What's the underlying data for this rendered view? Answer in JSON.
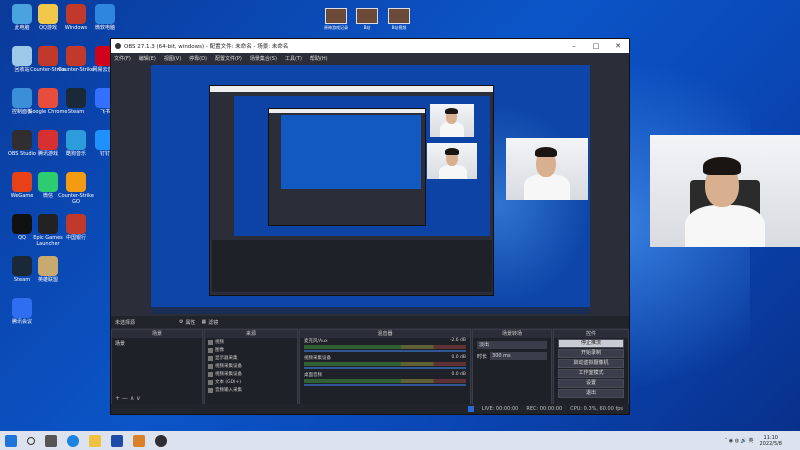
{
  "desktop": {
    "icons": [
      {
        "label": "此电脑",
        "color": "#4aa3df"
      },
      {
        "label": "QQ游戏",
        "color": "#f2c84b"
      },
      {
        "label": "Windows",
        "color": "#c0392b"
      },
      {
        "label": "微软电脑",
        "color": "#2e86de"
      },
      {
        "label": "回收站",
        "color": "#9ec9e8"
      },
      {
        "label": "Counter-Strike",
        "color": "#c0392b"
      },
      {
        "label": "Counter-Strike",
        "color": "#c0392b"
      },
      {
        "label": "控制面板",
        "color": "#3b8fd8"
      },
      {
        "label": "Google Chrome",
        "color": "#e74c3c"
      },
      {
        "label": "Steam",
        "color": "#1b2838"
      },
      {
        "label": "网易云音乐",
        "color": "#d0021b"
      },
      {
        "label": "OBS Studio",
        "color": "#302e31"
      },
      {
        "label": "腾讯游戏",
        "color": "#d63031"
      },
      {
        "label": "酷狗音乐",
        "color": "#2d9cdb"
      },
      {
        "label": "WeGame",
        "color": "#e84118"
      },
      {
        "label": "微信",
        "color": "#2ecc71"
      },
      {
        "label": "Counter-Strike GO",
        "color": "#f39c12"
      },
      {
        "label": "飞书",
        "color": "#3370ff"
      },
      {
        "label": "钉钉",
        "color": "#1e90ff"
      },
      {
        "label": "QQ",
        "color": "#111"
      },
      {
        "label": "Steam",
        "color": "#1b2838"
      },
      {
        "label": "Epic Games Launcher",
        "color": "#222"
      },
      {
        "label": "中国银行",
        "color": "#c0392b"
      },
      {
        "label": "腾讯会议",
        "color": "#2f6ef0"
      },
      {
        "label": "英雄联盟",
        "color": "#c8aa6e"
      }
    ],
    "top_files": [
      "原神游戏记录",
      "B站",
      "B站视频"
    ]
  },
  "obs": {
    "title": "OBS 27.1.3 (64-bit, windows) - 配置文件: 未命名 - 场景: 未命名",
    "menu": [
      "文件(F)",
      "编辑(E)",
      "视图(V)",
      "停靠(D)",
      "配置文件(P)",
      "场景集合(S)",
      "工具(T)",
      "帮助(H)"
    ],
    "no_source": "未选择源",
    "properties_label": "属性",
    "filters_label": "滤镜",
    "scenes_header": "场景",
    "scene_item": "场景",
    "sources_header": "来源",
    "sources": [
      "视频",
      "图像",
      "显示器采集",
      "视频采集设备",
      "视频采集设备",
      "文本 (GDI+)",
      "音频输入采集"
    ],
    "mixer_header": "混音器",
    "mixer": [
      {
        "name": "麦克风/Aux",
        "db": "-2.6 dB"
      },
      {
        "name": "视频采集设备",
        "db": "0.0 dB"
      },
      {
        "name": "桌面音频",
        "db": "0.0 dB"
      }
    ],
    "transitions_header": "场景转场",
    "transition_type": "淡出",
    "duration_label": "时长",
    "duration_value": "300 ms",
    "controls_header": "控件",
    "controls": [
      "停止推流",
      "开始录制",
      "启动虚拟摄像机",
      "工作室模式",
      "设置",
      "退出"
    ],
    "status": {
      "live": "LIVE: 00:00:00",
      "rec": "REC: 00:00:00",
      "cpu": "CPU: 0.3%, 60.00 fps"
    }
  },
  "taskbar": {
    "time": "11:10",
    "date": "2022/5/8"
  }
}
